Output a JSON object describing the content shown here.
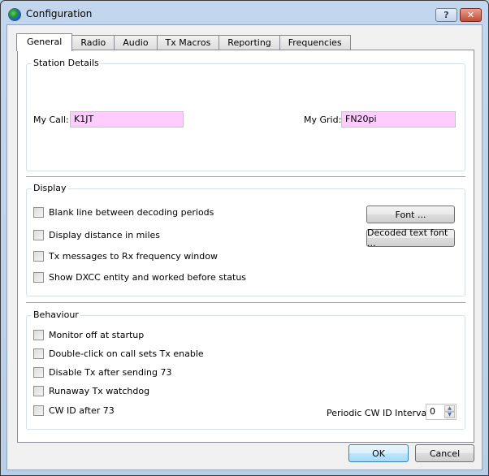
{
  "window": {
    "title": "Configuration",
    "help_label": "?",
    "close_label": "✕"
  },
  "tabs": [
    {
      "label": "General",
      "active": true
    },
    {
      "label": "Radio",
      "active": false
    },
    {
      "label": "Audio",
      "active": false
    },
    {
      "label": "Tx Macros",
      "active": false
    },
    {
      "label": "Reporting",
      "active": false
    },
    {
      "label": "Frequencies",
      "active": false
    }
  ],
  "station": {
    "title": "Station Details",
    "my_call_label": "My Call:",
    "my_call_value": "K1JT",
    "my_grid_label": "My Grid:",
    "my_grid_value": "FN20pi"
  },
  "display": {
    "title": "Display",
    "checkboxes": [
      {
        "label": "Blank line between decoding periods",
        "checked": false
      },
      {
        "label": "Display distance in miles",
        "checked": false
      },
      {
        "label": "Tx messages to Rx frequency window",
        "checked": false
      },
      {
        "label": "Show DXCC entity and worked before status",
        "checked": false
      }
    ],
    "font_button": "Font ...",
    "decoded_font_button": "Decoded text font ..."
  },
  "behaviour": {
    "title": "Behaviour",
    "checkboxes": [
      {
        "label": "Monitor off at startup",
        "checked": false
      },
      {
        "label": "Double-click on call sets Tx enable",
        "checked": false
      },
      {
        "label": "Disable Tx after sending 73",
        "checked": false
      },
      {
        "label": "Runaway Tx watchdog",
        "checked": false
      },
      {
        "label": "CW ID after 73",
        "checked": false
      }
    ],
    "cw_interval_label": "Periodic CW ID Interval:",
    "cw_interval_value": "0"
  },
  "footer": {
    "ok_label": "OK",
    "cancel_label": "Cancel"
  }
}
